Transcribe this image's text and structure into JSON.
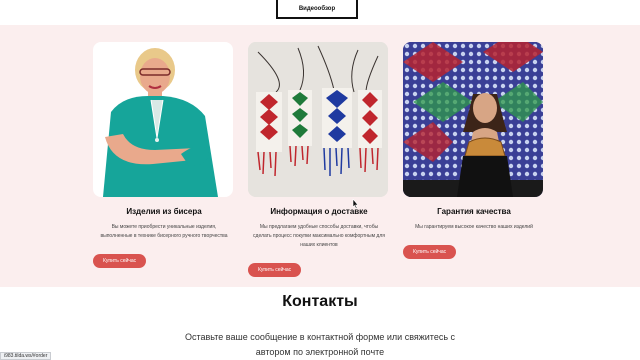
{
  "header": {
    "video_button": "Видеообзор"
  },
  "cards": [
    {
      "title": "Изделия из бисера",
      "description": "Вы можете приобрести уникальные изделия, выполненные в технике бисерного ручного творчества",
      "button": "Купить сейчас"
    },
    {
      "title": "Информация о доставке",
      "description": "Мы предлагаем удобные способы доставки, чтобы сделать процесс покупки максимально комфортным для наших клиентов",
      "button": "Купить сейчас"
    },
    {
      "title": "Гарантия качества",
      "description": "Мы гарантируем высокое качество наших изделий",
      "button": "Купить сейчас"
    }
  ],
  "contacts": {
    "heading": "Контакты",
    "text": "Оставьте ваше сообщение в контактной форме или свяжитесь с автором по электронной почте"
  },
  "status_url": "i983.tilda.ws/#order",
  "colors": {
    "section_bg": "#fbeeee",
    "accent": "#d9534f"
  }
}
